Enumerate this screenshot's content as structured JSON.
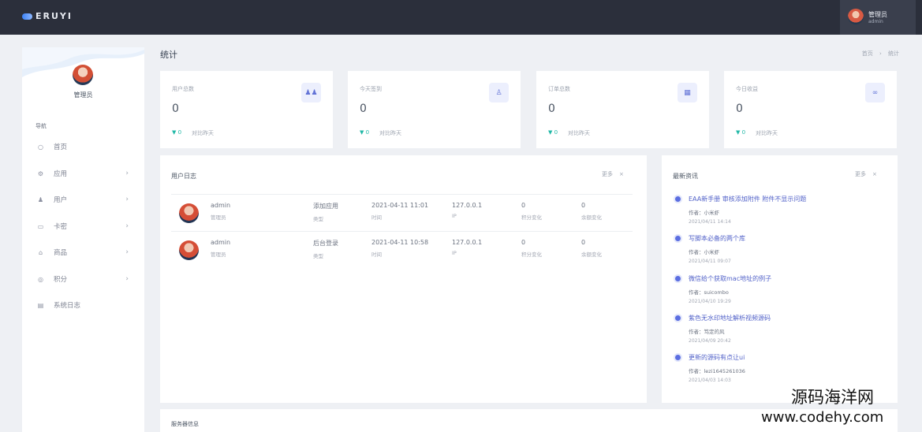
{
  "topbar": {
    "logo_text": "ERUYI",
    "user_name": "管理员",
    "user_role": "admin"
  },
  "sidebar": {
    "profile_name": "管理员",
    "nav_heading": "导航",
    "items": [
      {
        "label": "首页",
        "icon": "circle-icon"
      },
      {
        "label": "应用",
        "icon": "gear-icon"
      },
      {
        "label": "用户",
        "icon": "user-icon"
      },
      {
        "label": "卡密",
        "icon": "card-icon"
      },
      {
        "label": "商品",
        "icon": "cart-icon"
      },
      {
        "label": "积分",
        "icon": "points-icon"
      },
      {
        "label": "系统日志",
        "icon": "log-icon"
      }
    ]
  },
  "header": {
    "title": "统计",
    "breadcrumb": [
      "首页",
      "统计"
    ]
  },
  "stats": [
    {
      "title": "用户总数",
      "value": "0",
      "trend": "0",
      "compare": "对比昨天",
      "icon": "users-icon"
    },
    {
      "title": "今天签到",
      "value": "0",
      "trend": "0",
      "compare": "对比昨天",
      "icon": "sign-in-icon"
    },
    {
      "title": "订单总数",
      "value": "0",
      "trend": "0",
      "compare": "对比昨天",
      "icon": "calendar-icon"
    },
    {
      "title": "今日收益",
      "value": "0",
      "trend": "0",
      "compare": "对比昨天",
      "icon": "link-icon"
    }
  ],
  "user_log": {
    "title": "用户日志",
    "more": "更多",
    "rows": [
      {
        "name": "admin",
        "role": "管理员",
        "action": "添加应用",
        "action_label": "类型",
        "time": "2021-04-11 11:01",
        "time_label": "时间",
        "ip": "127.0.0.1",
        "ip_label": "IP",
        "points": "0",
        "points_label": "积分变化",
        "balance": "0",
        "balance_label": "余额变化"
      },
      {
        "name": "admin",
        "role": "管理员",
        "action": "后台登录",
        "action_label": "类型",
        "time": "2021-04-11 10:58",
        "time_label": "时间",
        "ip": "127.0.0.1",
        "ip_label": "IP",
        "points": "0",
        "points_label": "积分变化",
        "balance": "0",
        "balance_label": "余额变化"
      }
    ]
  },
  "news": {
    "title": "最新资讯",
    "more": "更多",
    "items": [
      {
        "title": "EAA新手册 审核添加附件 附件不显示问题",
        "author": "作者：小米虾",
        "date": "2021/04/11 14:14"
      },
      {
        "title": "写脚本必备的两个库",
        "author": "作者：小米虾",
        "date": "2021/04/11 09:07"
      },
      {
        "title": "微信给个获取mac地址的例子",
        "author": "作者：suicombo",
        "date": "2021/04/10 19:29"
      },
      {
        "title": "紫色无水印地址解析视频源码",
        "author": "作者：笃定的风",
        "date": "2021/04/09 20:42"
      },
      {
        "title": "更新的源码有点让ui",
        "author": "作者：lezi1645261036",
        "date": "2021/04/03 14:03"
      }
    ]
  },
  "server": {
    "title": "服务器信息"
  },
  "watermark": {
    "cn": "源码海洋网",
    "url": "www.codehy.com"
  }
}
